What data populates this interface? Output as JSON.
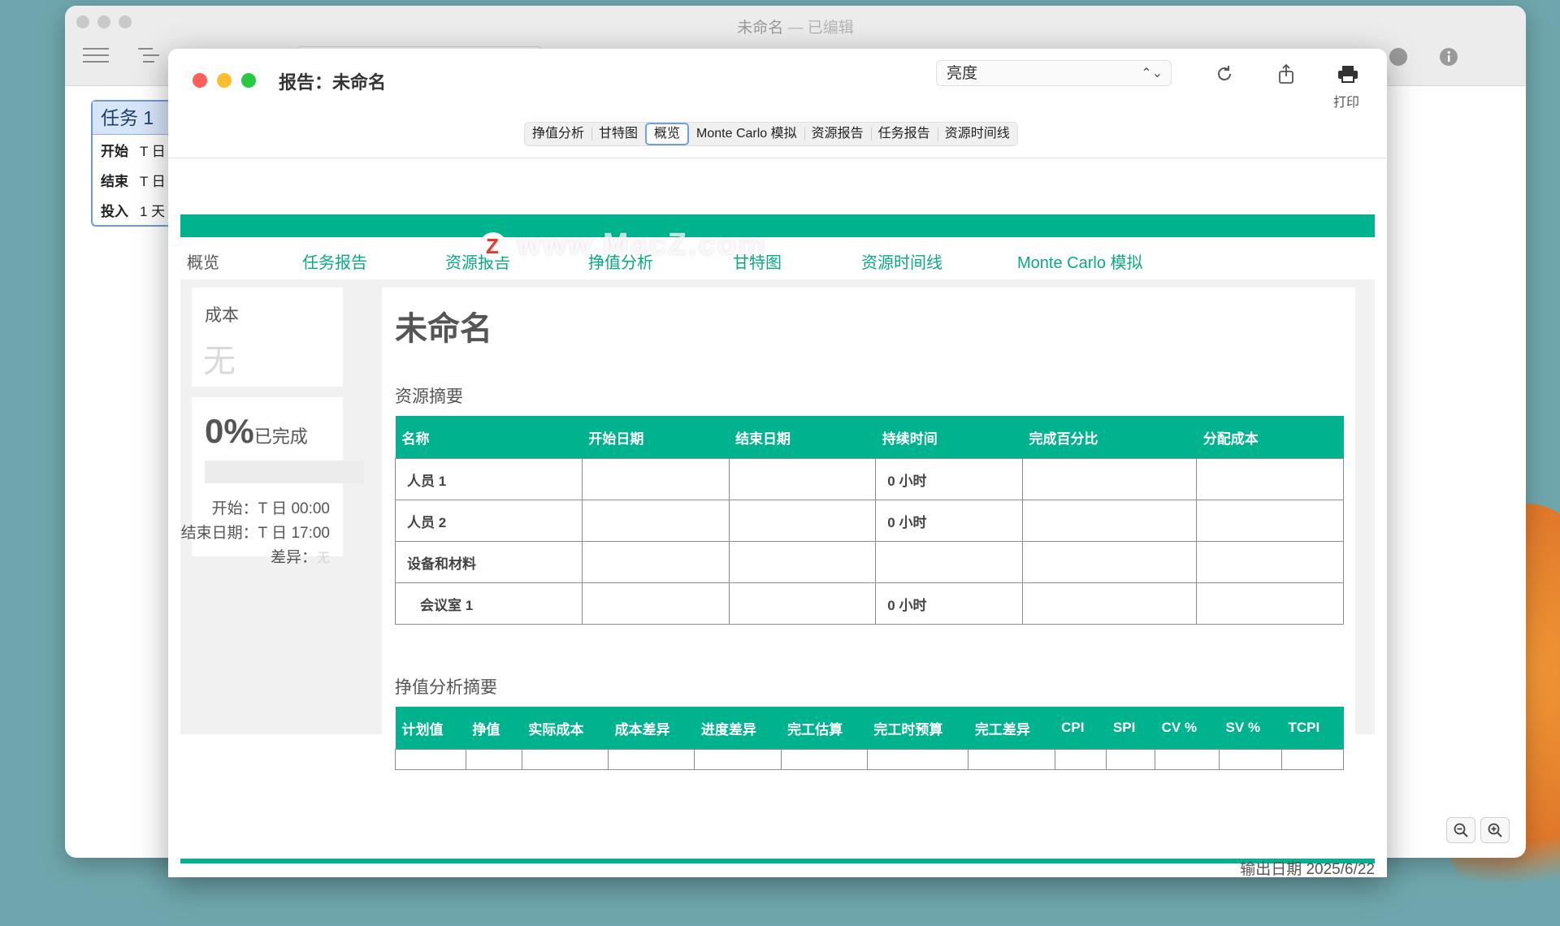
{
  "app": {
    "title": "未命名",
    "title_suffix": "— 已编辑",
    "task_card": {
      "name": "任务 1",
      "rows": [
        {
          "label": "开始",
          "value": "T 日"
        },
        {
          "label": "结束",
          "value": "T 日"
        },
        {
          "label": "投入",
          "value": "1 天"
        }
      ]
    }
  },
  "report": {
    "window_title": "报告：未命名",
    "theme_select": "亮度",
    "print_label": "打印",
    "segments": [
      "挣值分析",
      "甘特图",
      "概览",
      "Monte Carlo 模拟",
      "资源报告",
      "任务报告",
      "资源时间线"
    ],
    "active_segment": "概览",
    "tabs": [
      "概览",
      "任务报告",
      "资源报告",
      "挣值分析",
      "甘特图",
      "资源时间线",
      "Monte Carlo 模拟"
    ],
    "sidebar": {
      "cost_label": "成本",
      "cost_value": "无",
      "percent": "0%",
      "percent_label": "已完成",
      "progress_fraction": 0,
      "start": "开始：T 日 00:00",
      "end": "结束日期：T 日 17:00",
      "variance_label": "差异：",
      "variance_value": "无"
    },
    "doc_title": "未命名",
    "resource_summary": {
      "title": "资源摘要",
      "headers": [
        "名称",
        "开始日期",
        "结束日期",
        "持续时间",
        "完成百分比",
        "分配成本"
      ],
      "rows": [
        [
          "人员 1",
          "",
          "",
          "0 小时",
          "",
          ""
        ],
        [
          "人员 2",
          "",
          "",
          "0 小时",
          "",
          ""
        ],
        [
          "设备和材料",
          "",
          "",
          "",
          "",
          ""
        ],
        [
          "会议室 1",
          "",
          "",
          "0 小时",
          "",
          ""
        ]
      ]
    },
    "ev_summary": {
      "title": "挣值分析摘要",
      "headers": [
        "计划值",
        "挣值",
        "实际成本",
        "成本差异",
        "进度差异",
        "完工估算",
        "完工时预算",
        "完工差异",
        "CPI",
        "SPI",
        "CV %",
        "SV %",
        "TCPI"
      ]
    },
    "export_date": "输出日期 2025/6/22"
  },
  "watermark": "www.MacZ.com",
  "colors": {
    "accent": "#00b38f",
    "tab_text": "#0aa983",
    "active_outline": "#6ea0e9"
  }
}
